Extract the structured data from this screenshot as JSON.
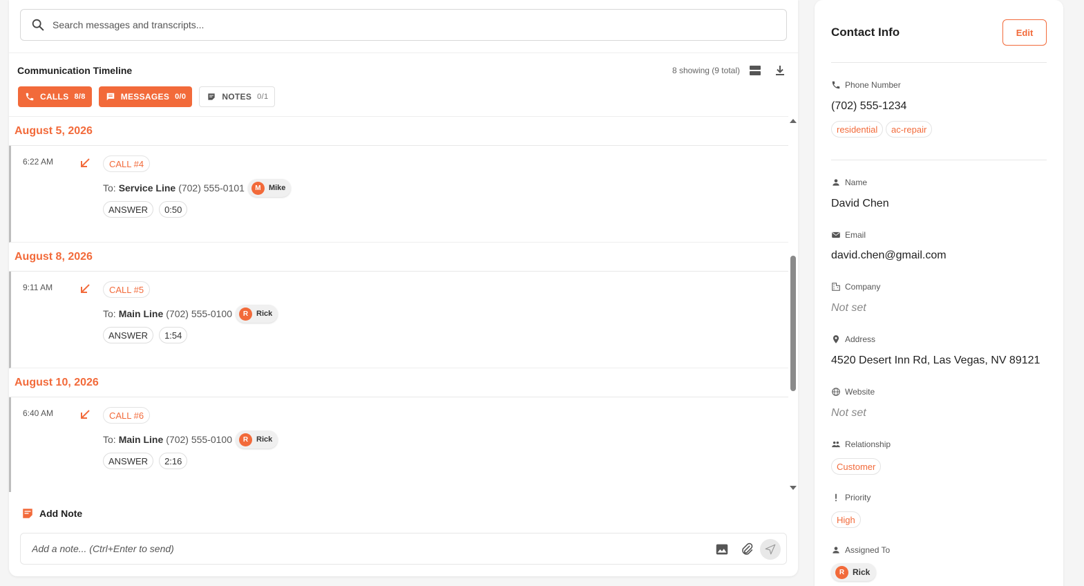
{
  "search": {
    "placeholder": "Search messages and transcripts..."
  },
  "timeline": {
    "title": "Communication Timeline",
    "count_text": "8 showing (9 total)",
    "filters": [
      {
        "label": "CALLS",
        "count": "8/8",
        "active": true,
        "icon": "phone-icon"
      },
      {
        "label": "MESSAGES",
        "count": "0/0",
        "active": true,
        "icon": "chat-icon"
      },
      {
        "label": "NOTES",
        "count": "0/1",
        "active": false,
        "icon": "note-icon"
      }
    ],
    "groups": [
      {
        "date": "August 5, 2026",
        "time": "6:22 AM",
        "call": "CALL #4",
        "to_prefix": "To:",
        "line": "Service Line",
        "number": "(702) 555-0101",
        "agent_initial": "M",
        "agent": "Mike",
        "status": "ANSWER",
        "duration": "0:50"
      },
      {
        "date": "August 8, 2026",
        "time": "9:11 AM",
        "call": "CALL #5",
        "to_prefix": "To:",
        "line": "Main Line",
        "number": "(702) 555-0100",
        "agent_initial": "R",
        "agent": "Rick",
        "status": "ANSWER",
        "duration": "1:54"
      },
      {
        "date": "August 10, 2026",
        "time": "6:40 AM",
        "call": "CALL #6",
        "to_prefix": "To:",
        "line": "Main Line",
        "number": "(702) 555-0100",
        "agent_initial": "R",
        "agent": "Rick",
        "status": "ANSWER",
        "duration": "2:16"
      }
    ]
  },
  "add_note": {
    "title": "Add Note",
    "placeholder": "Add a note... (Ctrl+Enter to send)"
  },
  "contact": {
    "title": "Contact Info",
    "edit_label": "Edit",
    "phone": {
      "label": "Phone Number",
      "value": "(702) 555-1234",
      "tags": [
        "residential",
        "ac-repair"
      ]
    },
    "name": {
      "label": "Name",
      "value": "David Chen"
    },
    "email": {
      "label": "Email",
      "value": "david.chen@gmail.com"
    },
    "company": {
      "label": "Company",
      "value": "Not set"
    },
    "address": {
      "label": "Address",
      "value": "4520 Desert Inn Rd, Las Vegas, NV 89121"
    },
    "website": {
      "label": "Website",
      "value": "Not set"
    },
    "relationship": {
      "label": "Relationship",
      "value": "Customer"
    },
    "priority": {
      "label": "Priority",
      "value": "High"
    },
    "assigned": {
      "label": "Assigned To",
      "initial": "R",
      "value": "Rick"
    }
  },
  "colors": {
    "accent": "#f26a3a",
    "muted": "#555555",
    "border": "#e3e3e3"
  }
}
